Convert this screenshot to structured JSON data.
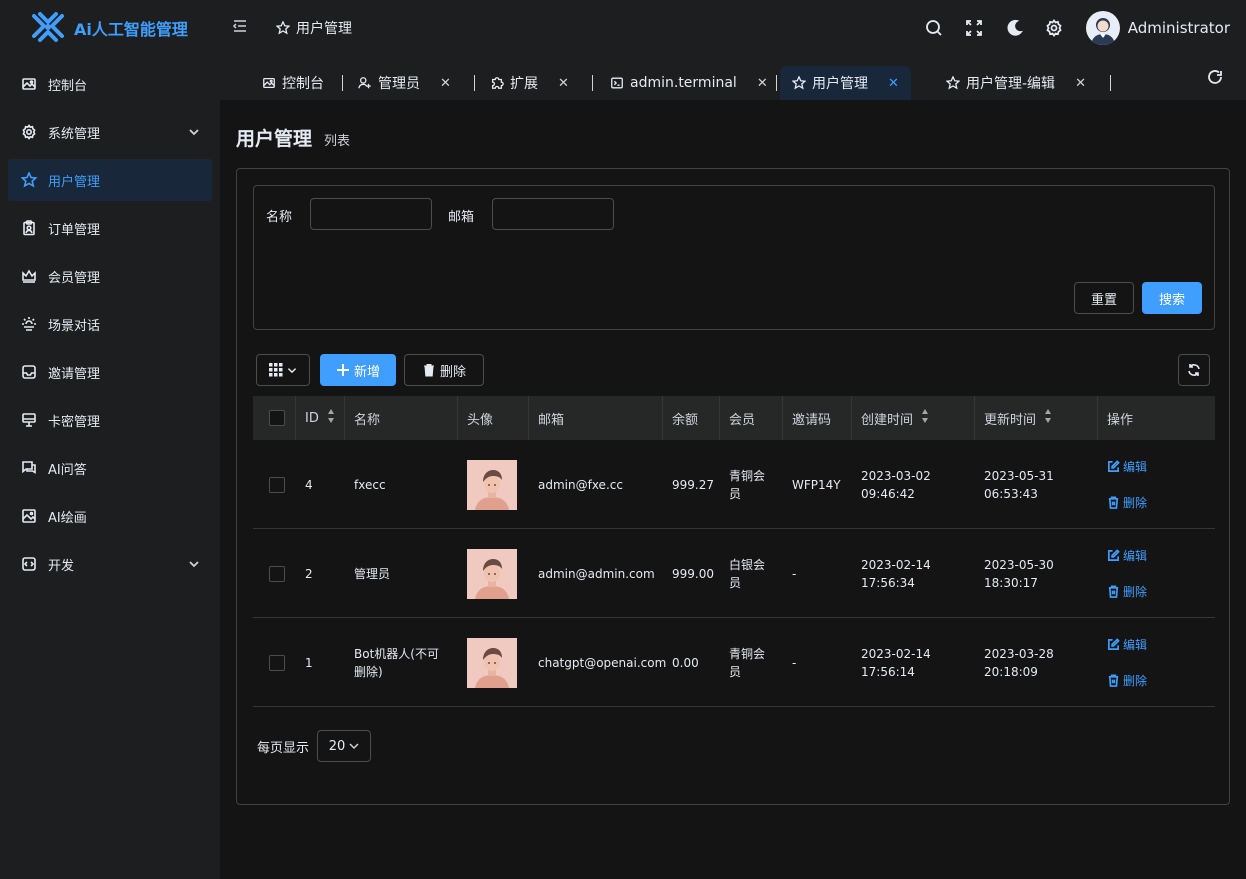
{
  "app": {
    "logo_text": "Ai人工智能管理"
  },
  "sidebar": {
    "items": [
      {
        "label": "控制台",
        "icon": "image-icon"
      },
      {
        "label": "系统管理",
        "icon": "gear-icon",
        "expandable": true
      },
      {
        "label": "用户管理",
        "icon": "user-star-icon",
        "active": true
      },
      {
        "label": "订单管理",
        "icon": "clipboard-icon"
      },
      {
        "label": "会员管理",
        "icon": "crown-icon"
      },
      {
        "label": "场景对话",
        "icon": "scene-icon"
      },
      {
        "label": "邀请管理",
        "icon": "inbox-icon"
      },
      {
        "label": "卡密管理",
        "icon": "monitor-icon"
      },
      {
        "label": "AI问答",
        "icon": "chat-icon"
      },
      {
        "label": "AI绘画",
        "icon": "picture-icon"
      },
      {
        "label": "开发",
        "icon": "dev-icon",
        "expandable": true
      }
    ]
  },
  "topbar": {
    "breadcrumb": "用户管理",
    "user_name": "Administrator"
  },
  "tabs": [
    {
      "label": "控制台",
      "icon": "image-icon",
      "closable": false
    },
    {
      "label": "管理员",
      "icon": "user-add-icon",
      "closable": true
    },
    {
      "label": "扩展",
      "icon": "puzzle-icon",
      "closable": true
    },
    {
      "label": "admin.terminal",
      "icon": "terminal-icon",
      "closable": true
    },
    {
      "label": "用户管理",
      "icon": "user-star-icon",
      "closable": true,
      "active": true
    },
    {
      "label": "用户管理-编辑",
      "icon": "user-star-icon",
      "closable": true
    }
  ],
  "page": {
    "title": "用户管理",
    "subtitle": "列表"
  },
  "filter": {
    "name_label": "名称",
    "name_value": "",
    "email_label": "邮箱",
    "email_value": "",
    "reset_label": "重置",
    "search_label": "搜索"
  },
  "toolbar": {
    "add_label": "新增",
    "delete_label": "删除"
  },
  "table": {
    "headers": [
      "ID",
      "名称",
      "头像",
      "邮箱",
      "余额",
      "会员",
      "邀请码",
      "创建时间",
      "更新时间",
      "操作"
    ],
    "edit_label": "编辑",
    "delete_label": "删除",
    "rows": [
      {
        "id": "4",
        "name": "fxecc",
        "email": "admin@fxe.cc",
        "balance": "999.27",
        "member": "青铜会员",
        "invite": "WFP14Y",
        "created": "2023-03-02 09:46:42",
        "updated": "2023-05-31 06:53:43"
      },
      {
        "id": "2",
        "name": "管理员",
        "email": "admin@admin.com",
        "balance": "999.00",
        "member": "白银会员",
        "invite": "-",
        "created": "2023-02-14 17:56:34",
        "updated": "2023-05-30 18:30:17"
      },
      {
        "id": "1",
        "name": "Bot机器人(不可删除)",
        "email": "chatgpt@openai.com",
        "balance": "0.00",
        "member": "青铜会员",
        "invite": "-",
        "created": "2023-02-14 17:56:14",
        "updated": "2023-03-28 20:18:09"
      }
    ]
  },
  "pager": {
    "label": "每页显示",
    "page_size": "20"
  },
  "colors": {
    "accent": "#409eff",
    "bg": "#141414",
    "panel": "#1d1e1f",
    "active_bg": "#18273a"
  }
}
